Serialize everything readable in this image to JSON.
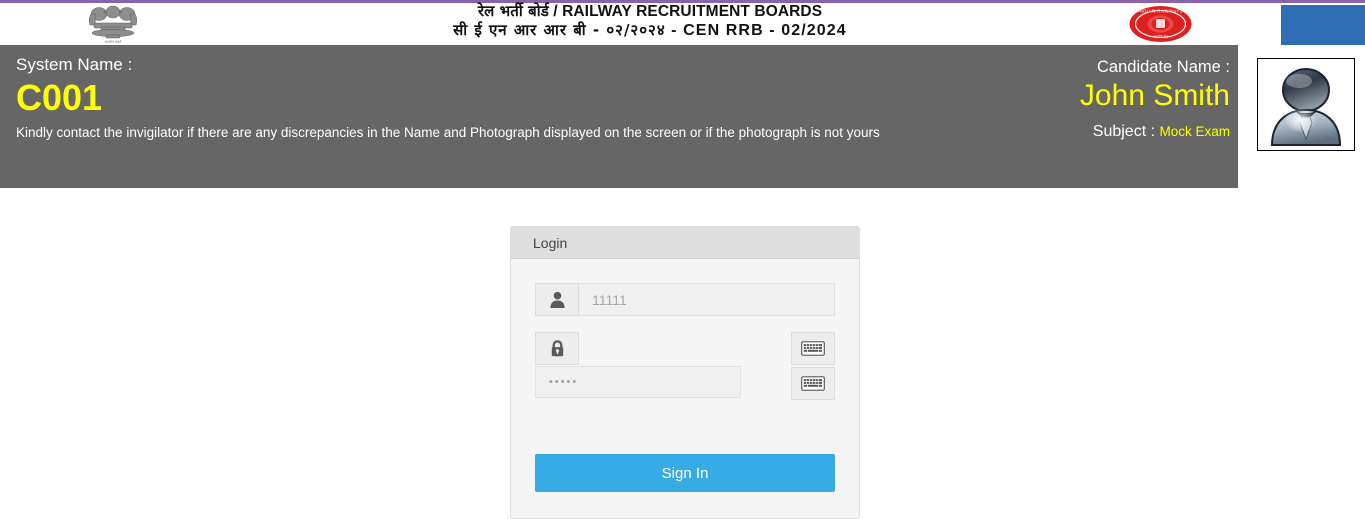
{
  "page": {
    "top_rule_color": "#8a63a8",
    "banner_bg": "#666666",
    "accent_yellow": "#ffff00",
    "signin_blue": "#37abe6",
    "blue_block_color": "#2f6eb5"
  },
  "masthead": {
    "emblem_icon": "ashoka-emblem-icon",
    "title_hindi": "रेल भर्ती बोर्ड",
    "title_separator": " / ",
    "title_english": "RAILWAY RECRUITMENT BOARDS",
    "subtitle_hindi": "सी ई एन  आर  आर  बी  -  ०२/२०२४",
    "subtitle_separator": "  -  ",
    "subtitle_english": "CEN  RRB  -  02/2024",
    "seal_icon": "indian-railways-seal-icon",
    "seal_text": "INDIAN RAILWAYS"
  },
  "banner": {
    "system_name_label": "System Name :",
    "system_name_value": "C001",
    "disclaimer": "Kindly contact the invigilator if there are any discrepancies in the Name and Photograph displayed on the screen or if the photograph is not yours",
    "candidate_name_label": "Candidate Name :",
    "candidate_name_value": "John Smith",
    "subject_label": "Subject :",
    "subject_value": "Mock Exam",
    "photo_icon": "candidate-photo-avatar-icon"
  },
  "login": {
    "panel_title": "Login",
    "username": {
      "icon": "user-icon",
      "value": "11111",
      "placeholder": "11111"
    },
    "password": {
      "icon": "lock-icon",
      "value": "•••••",
      "placeholder": ""
    },
    "keyboard_button_1": {
      "icon": "virtual-keyboard-icon",
      "label": ""
    },
    "keyboard_button_2": {
      "icon": "virtual-keyboard-icon",
      "label": ""
    },
    "signin_label": "Sign In"
  }
}
